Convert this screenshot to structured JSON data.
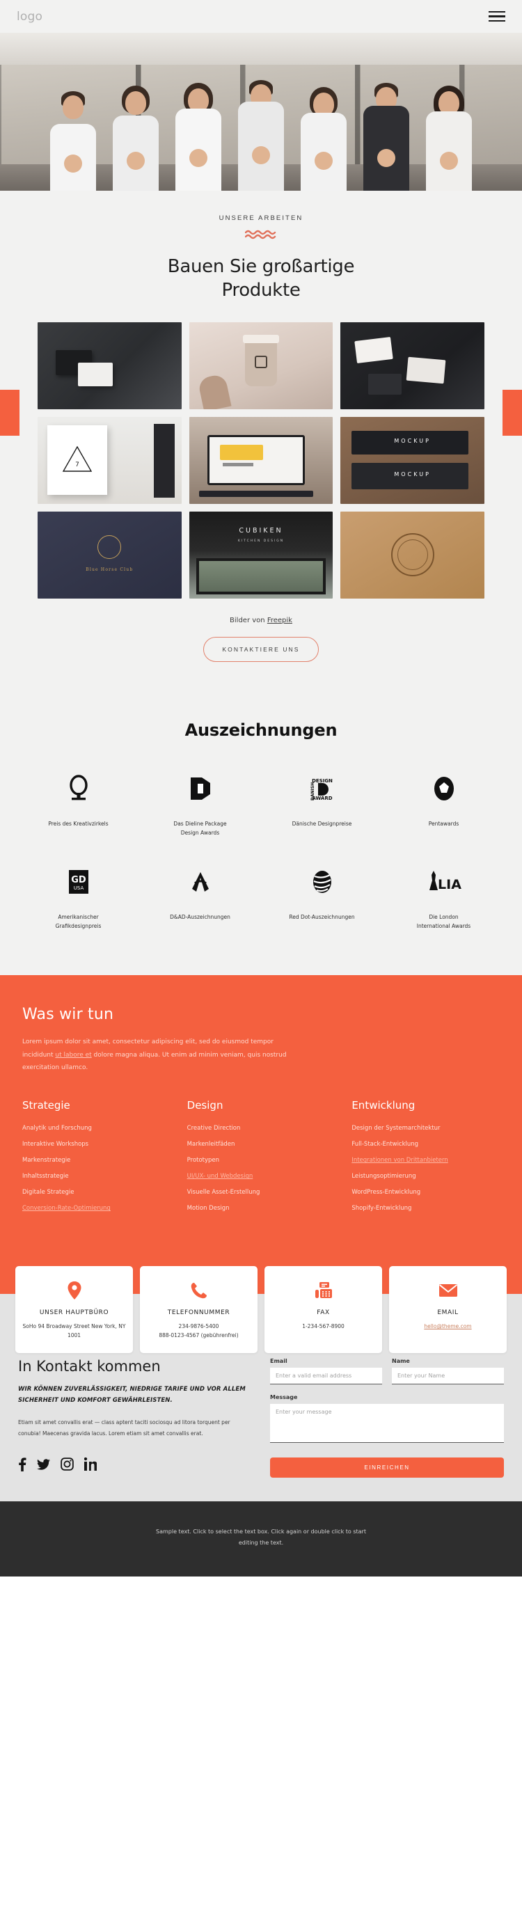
{
  "header": {
    "logo": "logo",
    "menu_icon": "hamburger-icon"
  },
  "hero": {
    "alt": "Team of colleagues giving thumbs up in an office"
  },
  "works": {
    "eyebrow": "UNSERE ARBEITEN",
    "title_line1": "Bauen Sie großartige",
    "title_line2": "Produkte",
    "credit_prefix": "Bilder von ",
    "credit_link": "Freepik",
    "cta_label": "KONTAKTIERE UNS",
    "tiles": [
      {
        "name": "black-business-card-stationery",
        "caption": ""
      },
      {
        "name": "coffee-cup-branding",
        "caption": ""
      },
      {
        "name": "dark-business-cards-signature",
        "caption": ""
      },
      {
        "name": "white-notebook-triangle-logo",
        "caption": ""
      },
      {
        "name": "laptop-branding-presentation",
        "caption": ""
      },
      {
        "name": "dark-box-mockup",
        "caption": ""
      },
      {
        "name": "navy-logo-crest-card",
        "caption": ""
      },
      {
        "name": "cubiken-storefront-sign",
        "caption": ""
      },
      {
        "name": "kraft-paper-stamp-logo",
        "caption": ""
      }
    ]
  },
  "awards": {
    "title": "Auszeichnungen",
    "items": [
      {
        "logo": "creative-circle-award-icon",
        "name": "Preis des Kreativzirkels"
      },
      {
        "logo": "dieline-package-d-icon",
        "name": "Das Dieline Package\nDesign Awards"
      },
      {
        "logo": "danish-design-award-icon",
        "name": "Dänische Designpreise"
      },
      {
        "logo": "pentawards-icon",
        "name": "Pentawards"
      },
      {
        "logo": "gd-usa-icon",
        "name": "Amerikanischer Grafikdesignpreis"
      },
      {
        "logo": "dandad-pencil-icon",
        "name": "D&AD-Auszeichnungen"
      },
      {
        "logo": "red-dot-sphere-icon",
        "name": "Red Dot-Auszeichnungen"
      },
      {
        "logo": "lia-statue-icon",
        "name": "Die London\nInternational Awards"
      }
    ]
  },
  "whatwedo": {
    "title": "Was wir tun",
    "paragraph_a": "Lorem ipsum dolor sit amet, consectetur adipiscing elit, sed do eiusmod tempor incididunt ",
    "paragraph_link": "ut labore et",
    "paragraph_b": " dolore magna aliqua. Ut enim ad minim veniam, quis nostrud exercitation ullamco.",
    "columns": [
      {
        "title": "Strategie",
        "items": [
          {
            "label": "Analytik und Forschung",
            "muted": false
          },
          {
            "label": "Interaktive Workshops",
            "muted": false
          },
          {
            "label": "Markenstrategie",
            "muted": false
          },
          {
            "label": "Inhaltsstrategie",
            "muted": false
          },
          {
            "label": "Digitale Strategie",
            "muted": false
          },
          {
            "label": "Conversion-Rate-Optimierung",
            "muted": true
          }
        ]
      },
      {
        "title": "Design",
        "items": [
          {
            "label": "Creative Direction",
            "muted": false
          },
          {
            "label": "Markenleitfäden",
            "muted": false
          },
          {
            "label": "Prototypen",
            "muted": false
          },
          {
            "label": "UI/UX- und Webdesign",
            "muted": true
          },
          {
            "label": "Visuelle Asset-Erstellung",
            "muted": false
          },
          {
            "label": "Motion Design",
            "muted": false
          }
        ]
      },
      {
        "title": "Entwicklung",
        "items": [
          {
            "label": "Design der Systemarchitektur",
            "muted": false
          },
          {
            "label": "Full-Stack-Entwicklung",
            "muted": false
          },
          {
            "label": "Integrationen von Drittanbietern",
            "muted": true
          },
          {
            "label": "Leistungsoptimierung",
            "muted": false
          },
          {
            "label": "WordPress-Entwicklung",
            "muted": false
          },
          {
            "label": "Shopify-Entwicklung",
            "muted": false
          }
        ]
      }
    ]
  },
  "contact_cards": [
    {
      "icon": "map-pin-icon",
      "title": "UNSER HAUPTBÜRO",
      "text": "SoHo 94 Broadway Street New York, NY 1001",
      "link": ""
    },
    {
      "icon": "phone-icon",
      "title": "TELEFONNUMMER",
      "text": "234-9876-5400\n888-0123-4567 (gebührenfrei)",
      "link": ""
    },
    {
      "icon": "fax-icon",
      "title": "FAX",
      "text": "1-234-567-8900",
      "link": ""
    },
    {
      "icon": "envelope-icon",
      "title": "EMAIL",
      "text": "",
      "link": "hello@theme.com"
    }
  ],
  "touch": {
    "title": "In Kontakt kommen",
    "subtitle": "WIR KÖNNEN ZUVERLÄSSIGKEIT, NIEDRIGE TARIFE UND VOR ALLEM SICHERHEIT UND KOMFORT GEWÄHRLEISTEN.",
    "body": "Etiam sit amet convallis erat — class aptent taciti sociosqu ad litora torquent per conubia! Maecenas gravida lacus. Lorem etiam sit amet convallis erat.",
    "form": {
      "email_label": "Email",
      "email_placeholder": "Enter a valid email address",
      "email_value": "",
      "name_label": "Name",
      "name_placeholder": "Enter your Name",
      "name_value": "",
      "message_label": "Message",
      "message_placeholder": "Enter your message",
      "message_value": "",
      "submit_label": "EINREICHEN"
    },
    "socials": [
      {
        "icon": "facebook-icon",
        "label": "f"
      },
      {
        "icon": "twitter-icon",
        "label": "t"
      },
      {
        "icon": "instagram-icon",
        "label": "ig"
      },
      {
        "icon": "linkedin-icon",
        "label": "in"
      }
    ]
  },
  "footer": {
    "text": "Sample text. Click to select the text box. Click again or double click to start editing the text."
  },
  "colors": {
    "accent": "#f4603f",
    "page_bg": "#f2f2f1",
    "band_bg": "#e3e3e3",
    "footer_bg": "#2e2e2e",
    "heading": "#1d1d1d"
  }
}
